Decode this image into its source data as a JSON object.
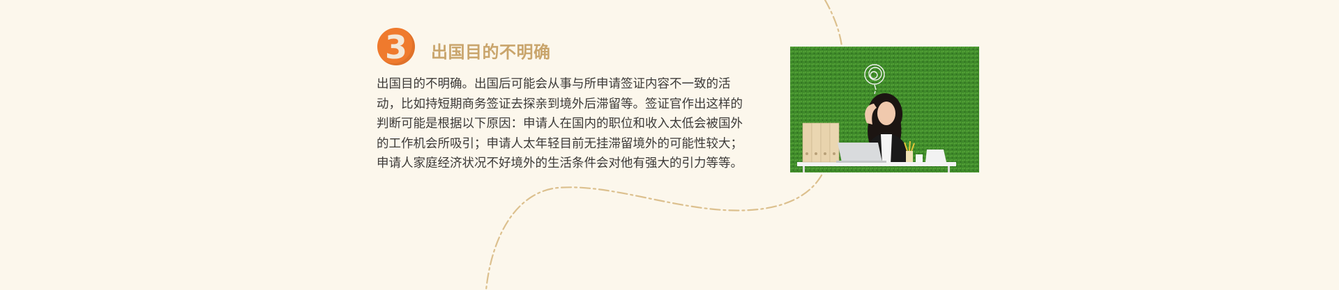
{
  "section": {
    "number": "3",
    "title": "出国目的不明确",
    "body": "出国目的不明确。出国后可能会从事与所申请签证内容不一致的活动，比如持短期商务签证去探亲到境外后滞留等。签证官作出这样的判断可能是根据以下原因：申请人在国内的职位和收入太低会被国外的工作机会所吸引；申请人太年轻目前无挂滞留境外的可能性较大；申请人家庭经济状况不好境外的生活条件会对他有强大的引力等等。"
  },
  "colors": {
    "background": "#fcf7ec",
    "badge": "#ef7a2d",
    "title": "#c9a56c",
    "dashed_path": "#dcc08e",
    "grass": "#3f8a2a"
  }
}
